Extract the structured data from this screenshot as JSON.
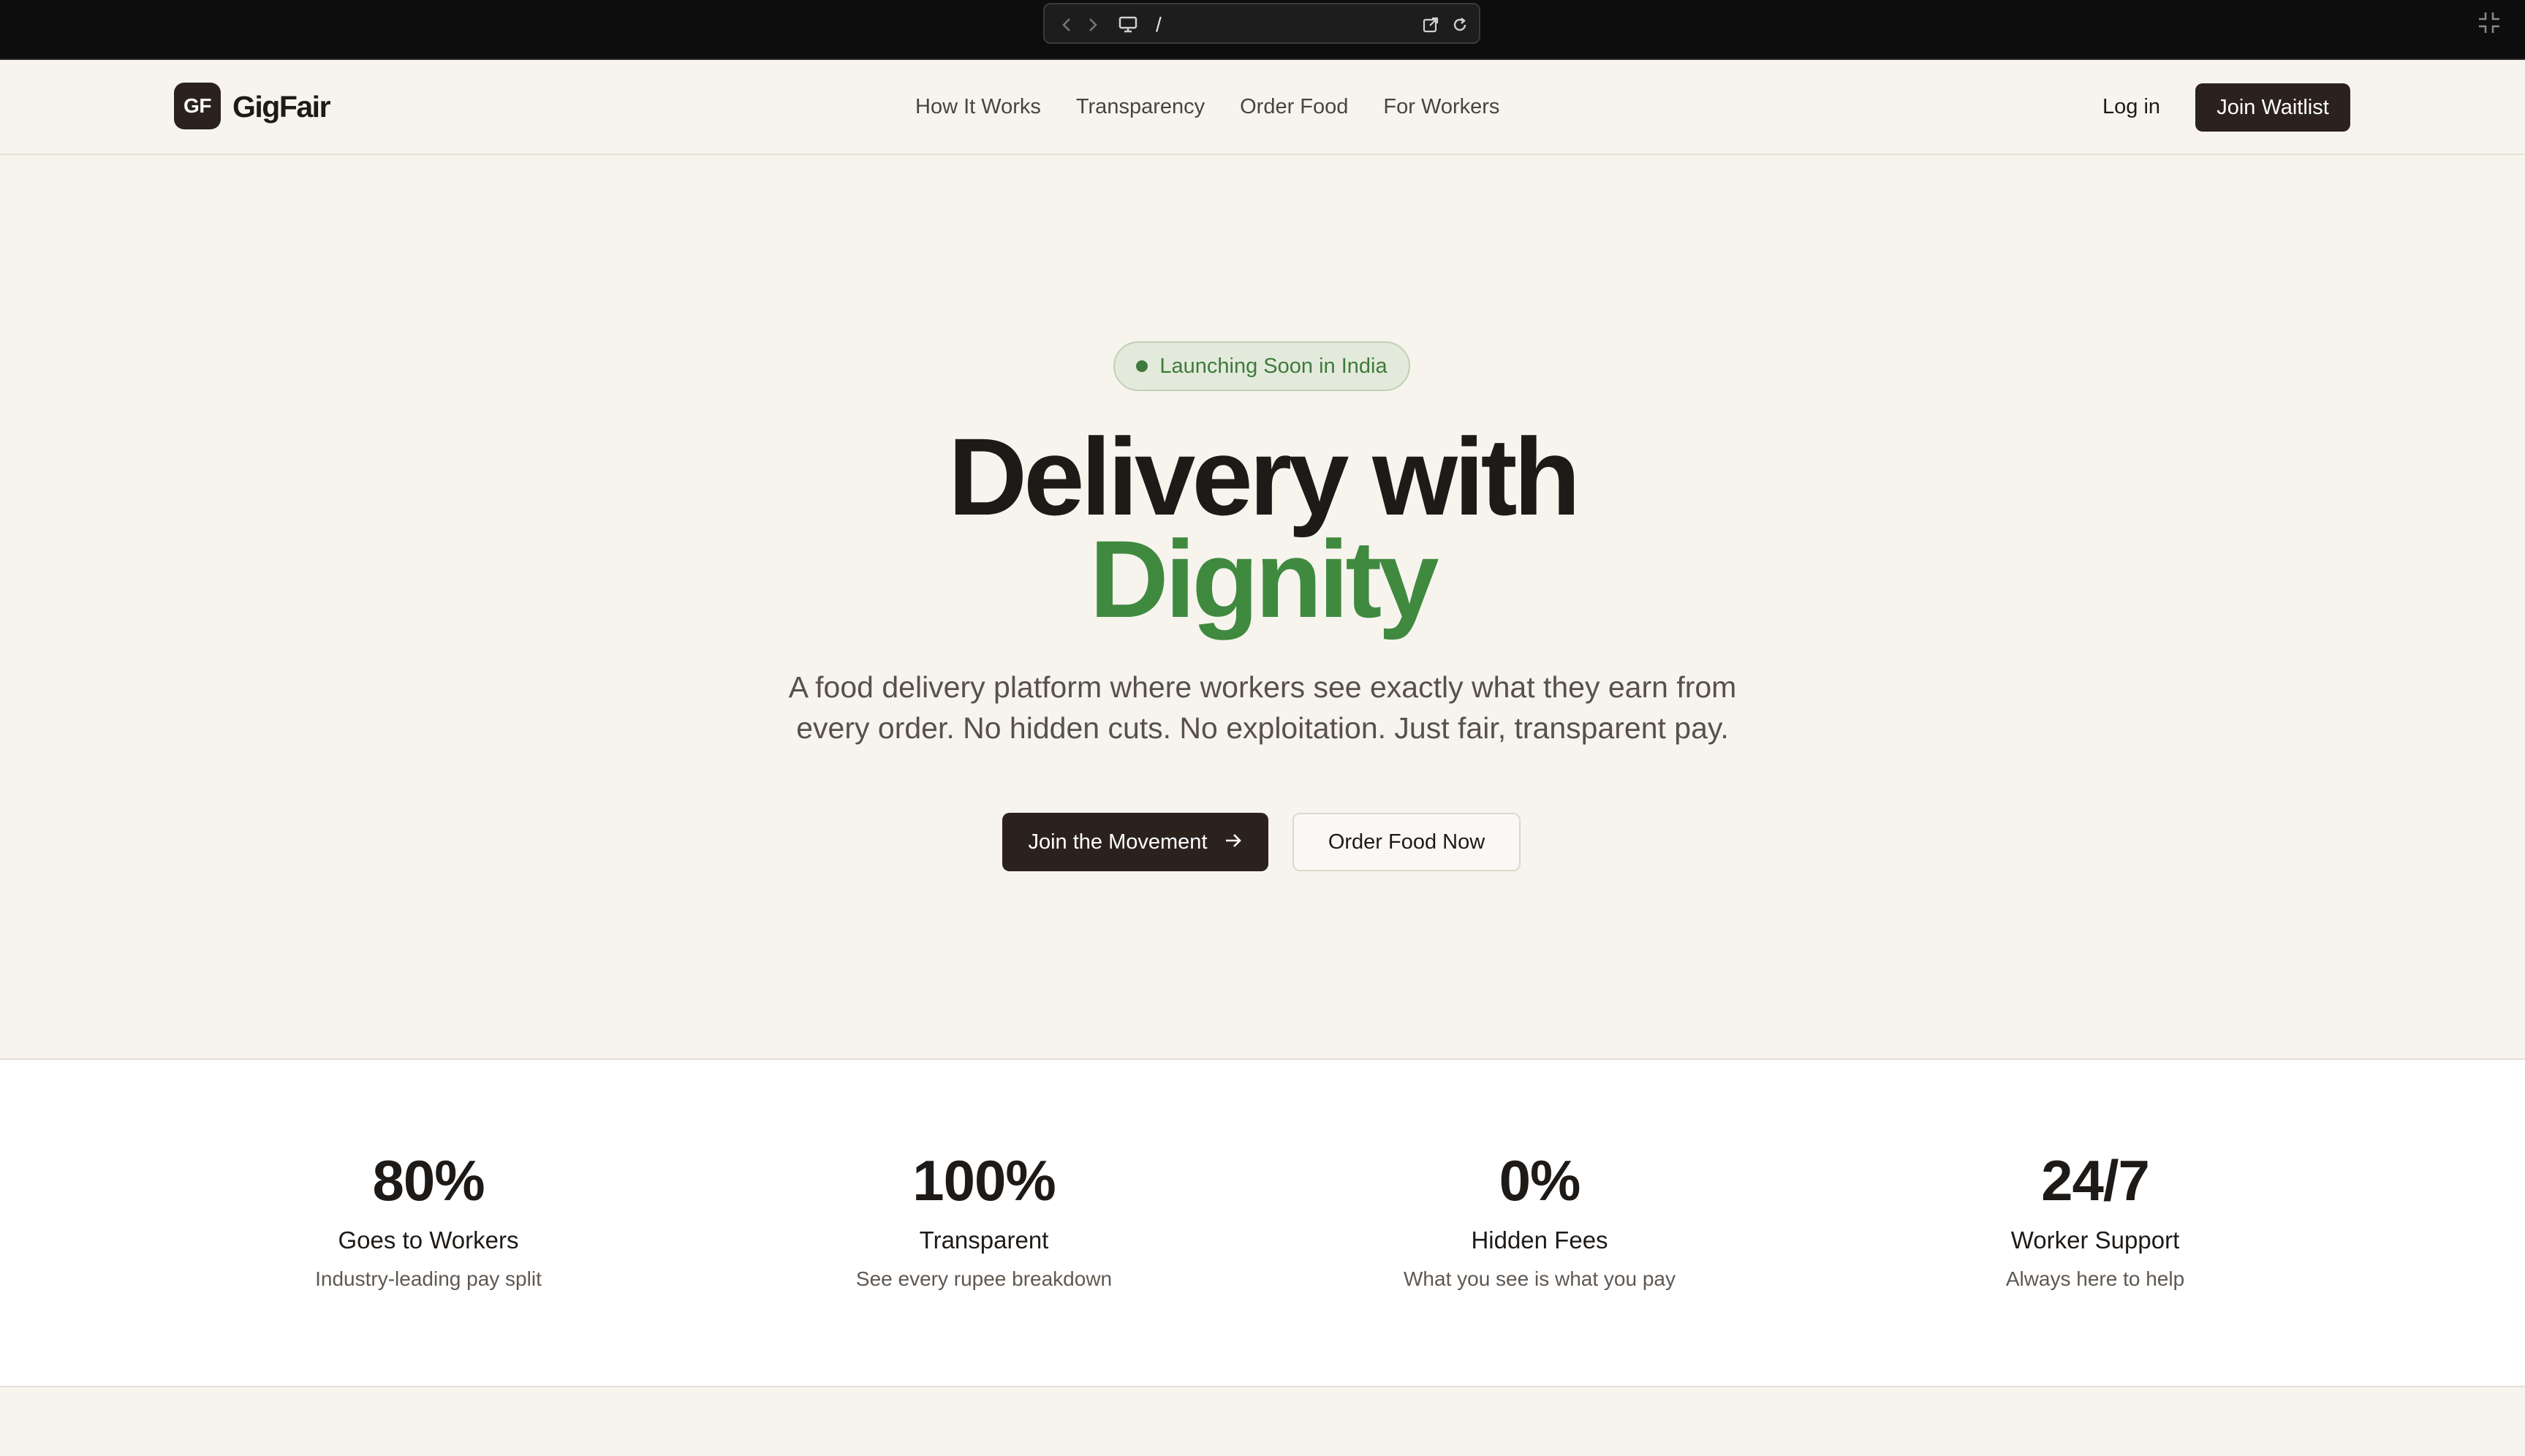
{
  "browser": {
    "url": "/",
    "icons": [
      "back-icon",
      "forward-icon",
      "monitor-icon",
      "open-external-icon",
      "reload-icon",
      "exit-fullscreen-icon"
    ]
  },
  "brand": {
    "mark": "GF",
    "name": "GigFair",
    "accent": "#3f8a3f",
    "dark": "#2b221e"
  },
  "nav": {
    "links": [
      "How It Works",
      "Transparency",
      "Order Food",
      "For Workers"
    ],
    "login": "Log in",
    "cta": "Join Waitlist"
  },
  "hero": {
    "badge": "Launching Soon in India",
    "headline_line1": "Delivery with",
    "headline_line2": "Dignity",
    "subtitle": "A food delivery platform where workers see exactly what they earn from every order. No hidden cuts. No exploitation. Just fair, transparent pay.",
    "primary_cta": "Join the Movement",
    "secondary_cta": "Order Food Now"
  },
  "stats": [
    {
      "value": "80%",
      "label": "Goes to Workers",
      "desc": "Industry-leading pay split"
    },
    {
      "value": "100%",
      "label": "Transparent",
      "desc": "See every rupee breakdown"
    },
    {
      "value": "0%",
      "label": "Hidden Fees",
      "desc": "What you see is what you pay"
    },
    {
      "value": "24/7",
      "label": "Worker Support",
      "desc": "Always here to help"
    }
  ]
}
